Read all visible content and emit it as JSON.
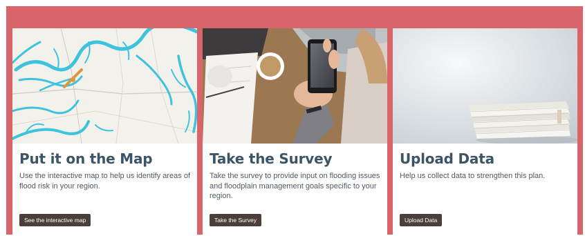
{
  "cards": [
    {
      "title": "Put it on the Map",
      "description": "Use the interactive map to help us identify areas of flood risk in your region.",
      "button_label": "See the interactive map"
    },
    {
      "title": "Take the Survey",
      "description": "Take the survey to provide input on flooding issues and floodplain management goals specific to your region.",
      "button_label": "Take the Survey"
    },
    {
      "title": "Upload Data",
      "description": "Help us collect data to strengthen this plan.",
      "button_label": "Upload Data"
    }
  ],
  "colors": {
    "panel_background": "#d9646a",
    "title_text": "#3c5566",
    "button_background": "#4a3f3b"
  }
}
